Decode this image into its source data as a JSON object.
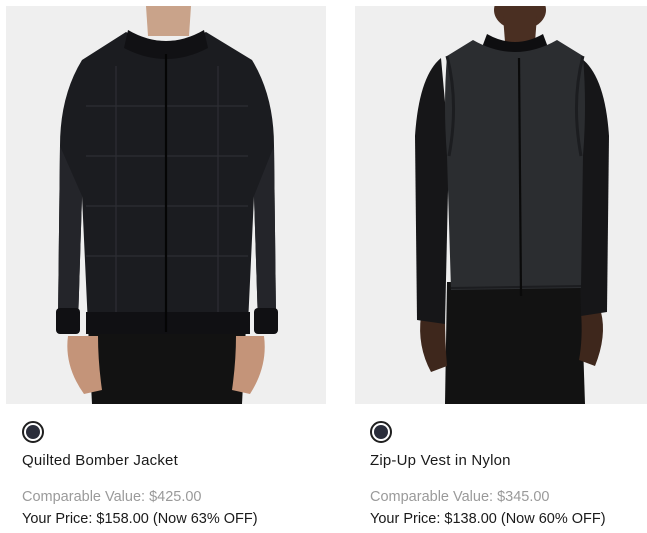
{
  "products": [
    {
      "name": "Quilted Bomber Jacket",
      "comparable_value": "Comparable Value: $425.00",
      "your_price": "Your Price: $158.00 (Now 63% OFF)",
      "swatch_color": "#2a2d3a"
    },
    {
      "name": "Zip-Up Vest in Nylon",
      "comparable_value": "Comparable Value: $345.00",
      "your_price": "Your Price: $138.00 (Now 60% OFF)",
      "swatch_color": "#2a2d3a"
    }
  ],
  "colors": {
    "image_background": "#efefef",
    "text_primary": "#1a1a1a",
    "text_muted": "#9a9a9a"
  }
}
